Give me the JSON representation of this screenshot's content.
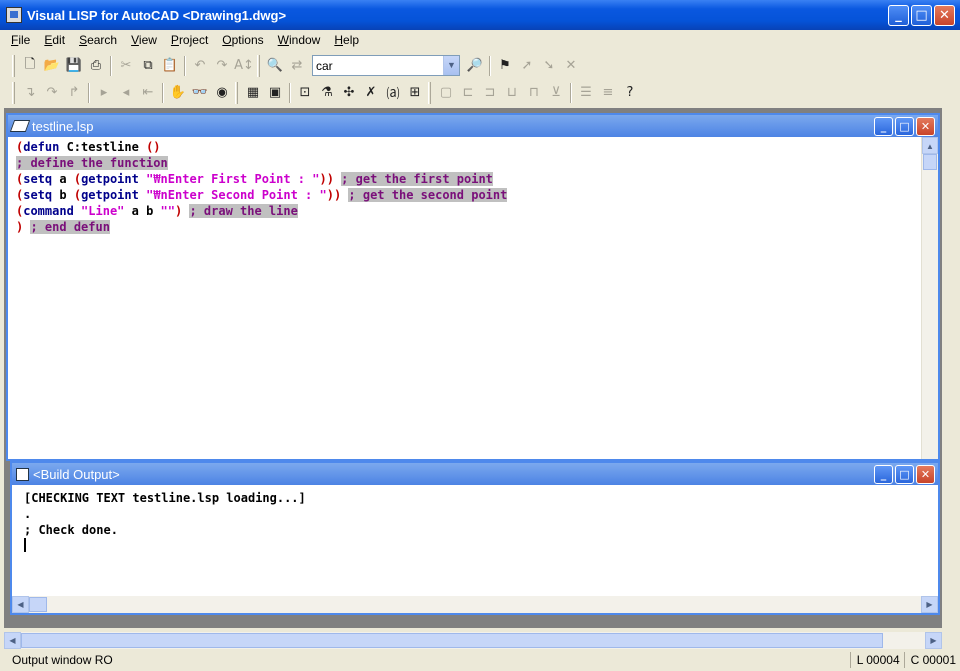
{
  "window": {
    "title": "Visual LISP for AutoCAD <Drawing1.dwg>"
  },
  "menu": [
    "File",
    "Edit",
    "Search",
    "View",
    "Project",
    "Options",
    "Window",
    "Help"
  ],
  "toolbar": {
    "search_value": "car"
  },
  "editor": {
    "title": "testline.lsp",
    "lines": [
      {
        "segments": [
          {
            "t": "(",
            "c": "paren"
          },
          {
            "t": "defun",
            "c": "kw"
          },
          {
            "t": " C:testline ",
            "c": "txt"
          },
          {
            "t": "()",
            "c": "paren"
          }
        ]
      },
      {
        "segments": [
          {
            "t": "; define the function",
            "c": "cmt"
          }
        ]
      },
      {
        "segments": [
          {
            "t": "(",
            "c": "paren"
          },
          {
            "t": "setq",
            "c": "kw"
          },
          {
            "t": " a ",
            "c": "txt"
          },
          {
            "t": "(",
            "c": "paren"
          },
          {
            "t": "getpoint",
            "c": "kw"
          },
          {
            "t": " ",
            "c": "txt"
          },
          {
            "t": "\"₩nEnter First Point : \"",
            "c": "str"
          },
          {
            "t": "))",
            "c": "paren"
          },
          {
            "t": " ",
            "c": "txt"
          },
          {
            "t": "; get the first point",
            "c": "cmt"
          }
        ]
      },
      {
        "segments": [
          {
            "t": "(",
            "c": "paren"
          },
          {
            "t": "setq",
            "c": "kw"
          },
          {
            "t": " b ",
            "c": "txt"
          },
          {
            "t": "(",
            "c": "paren"
          },
          {
            "t": "getpoint",
            "c": "kw"
          },
          {
            "t": " ",
            "c": "txt"
          },
          {
            "t": "\"₩nEnter Second Point : \"",
            "c": "str"
          },
          {
            "t": "))",
            "c": "paren"
          },
          {
            "t": " ",
            "c": "txt"
          },
          {
            "t": "; get the second point",
            "c": "cmt"
          }
        ]
      },
      {
        "segments": [
          {
            "t": "(",
            "c": "paren"
          },
          {
            "t": "command",
            "c": "kw"
          },
          {
            "t": " ",
            "c": "txt"
          },
          {
            "t": "\"Line\"",
            "c": "str"
          },
          {
            "t": " a b ",
            "c": "txt"
          },
          {
            "t": "\"\"",
            "c": "str"
          },
          {
            "t": ")",
            "c": "paren"
          },
          {
            "t": " ",
            "c": "txt"
          },
          {
            "t": "; draw the line",
            "c": "cmt"
          }
        ]
      },
      {
        "segments": [
          {
            "t": ")",
            "c": "paren"
          },
          {
            "t": " ",
            "c": "txt"
          },
          {
            "t": "; end defun",
            "c": "cmt"
          }
        ]
      }
    ]
  },
  "output": {
    "title": "<Build Output>",
    "lines": [
      "[CHECKING TEXT testline.lsp loading...]",
      ".",
      "; Check done."
    ]
  },
  "status": {
    "message": "Output window RO",
    "line": "L 00004",
    "col": "C 00001"
  },
  "colors": {
    "paren": "#c00000",
    "keyword": "#00008b",
    "string": "#cc00cc",
    "comment": "#7a0f7a",
    "comment_bg": "#c0c0c0"
  }
}
